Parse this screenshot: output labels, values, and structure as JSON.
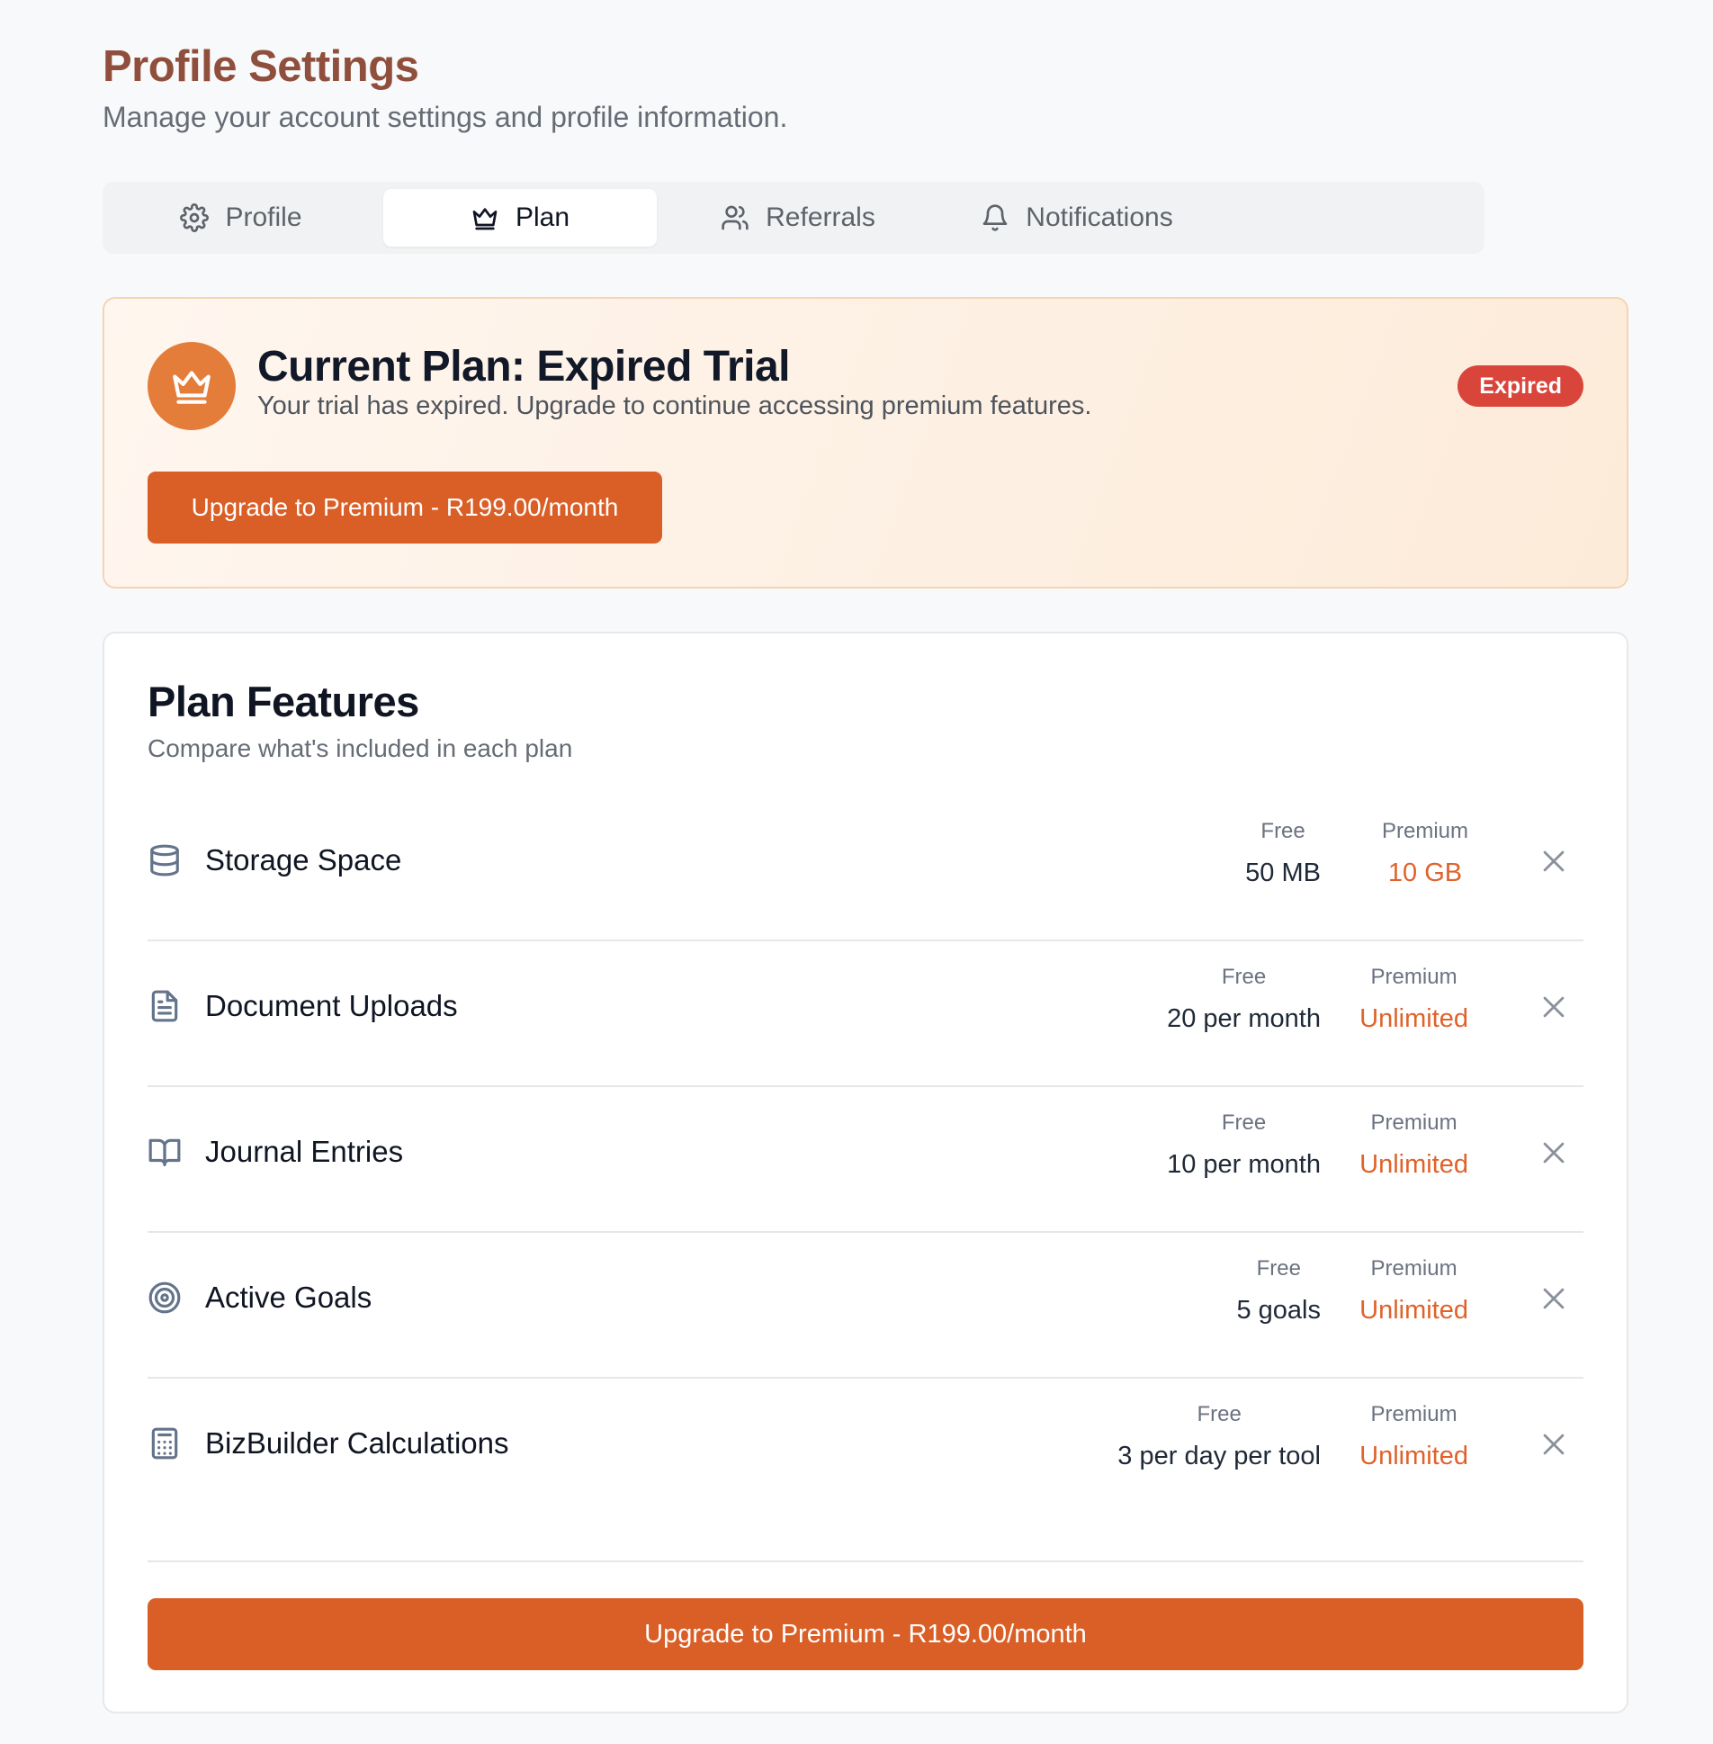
{
  "header": {
    "title": "Profile Settings",
    "subtitle": "Manage your account settings and profile information."
  },
  "tabs": [
    {
      "label": "Profile",
      "icon": "gear-icon",
      "active": false
    },
    {
      "label": "Plan",
      "icon": "crown-icon",
      "active": true
    },
    {
      "label": "Referrals",
      "icon": "users-icon",
      "active": false
    },
    {
      "label": "Notifications",
      "icon": "bell-icon",
      "active": false
    }
  ],
  "plan": {
    "icon": "crown-icon",
    "title": "Current Plan: Expired Trial",
    "description": "Your trial has expired. Upgrade to continue accessing premium features.",
    "badge": "Expired",
    "upgrade_label": "Upgrade to Premium - R199.00/month"
  },
  "features": {
    "title": "Plan Features",
    "subtitle": "Compare what's included in each plan",
    "free_label": "Free",
    "premium_label": "Premium",
    "rows": [
      {
        "icon": "database-icon",
        "name": "Storage Space",
        "free": "50 MB",
        "premium": "10 GB",
        "status_icon": "close-icon"
      },
      {
        "icon": "document-icon",
        "name": "Document Uploads",
        "free": "20 per month",
        "premium": "Unlimited",
        "status_icon": "close-icon"
      },
      {
        "icon": "book-icon",
        "name": "Journal Entries",
        "free": "10 per month",
        "premium": "Unlimited",
        "status_icon": "close-icon"
      },
      {
        "icon": "target-icon",
        "name": "Active Goals",
        "free": "5 goals",
        "premium": "Unlimited",
        "status_icon": "close-icon"
      },
      {
        "icon": "calculator-icon",
        "name": "BizBuilder Calculations",
        "free": "3 per day per tool",
        "premium": "Unlimited",
        "status_icon": "close-icon"
      }
    ],
    "upgrade_label": "Upgrade to Premium - R199.00/month"
  },
  "colors": {
    "accent": "#d95f27",
    "title": "#8f4f3c",
    "premium_value": "#e0622a",
    "badge": "#d9453b",
    "crown_circle": "#e47d39"
  }
}
